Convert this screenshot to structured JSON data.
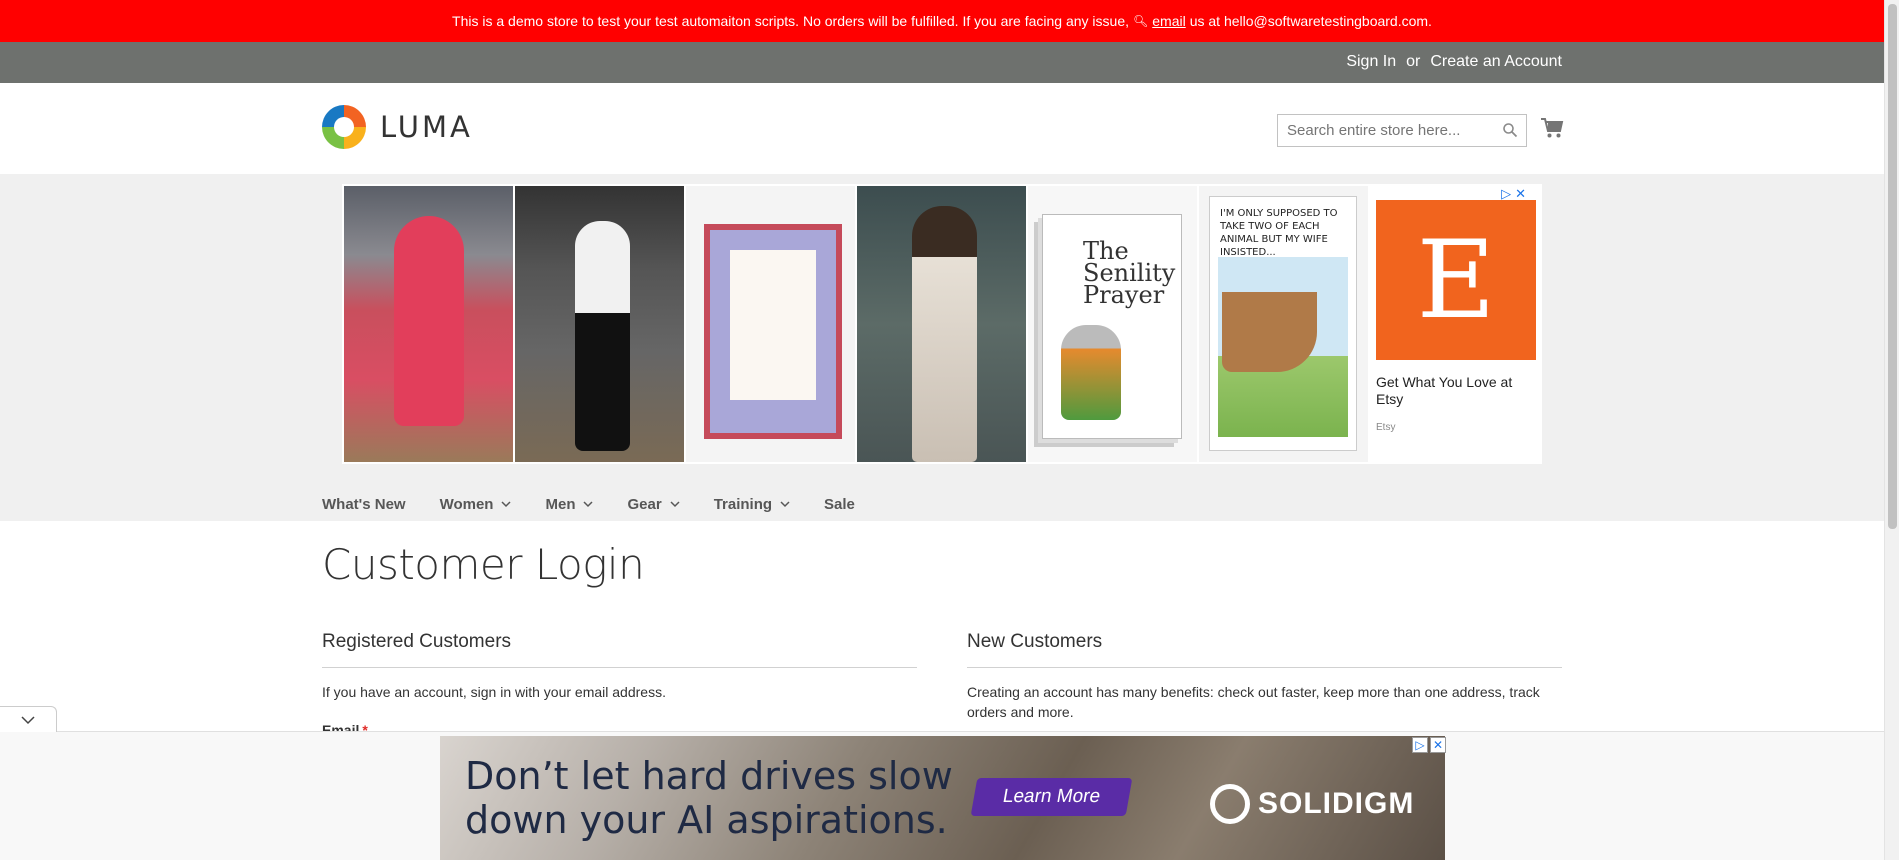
{
  "demo_notice": {
    "text_before": "This is a demo store to test your test automaiton scripts. No orders will be fulfilled. If you are facing any issue,",
    "link": "email",
    "text_after": "us at hello@softwaretestingboard.com."
  },
  "header_links": {
    "sign_in": "Sign In",
    "or": "or",
    "create_account": "Create an Account"
  },
  "logo": {
    "text": "LUMA"
  },
  "search": {
    "placeholder": "Search entire store here..."
  },
  "ads": {
    "card_caption": "I'M ONLY SUPPOSED TO TAKE TWO OF EACH ANIMAL BUT MY WIFE INSISTED...",
    "card_title": "The Senility Prayer",
    "etsy": {
      "logo_letter": "E",
      "headline": "Get What You Love at Etsy",
      "source": "Etsy"
    }
  },
  "nav": {
    "items": [
      {
        "label": "What's New"
      },
      {
        "label": "Women"
      },
      {
        "label": "Men"
      },
      {
        "label": "Gear"
      },
      {
        "label": "Training"
      },
      {
        "label": "Sale"
      }
    ]
  },
  "page": {
    "title": "Customer Login",
    "registered": {
      "title": "Registered Customers",
      "text": "If you have an account, sign in with your email address.",
      "email_label": "Email",
      "required_mark": "*"
    },
    "new_customers": {
      "title": "New Customers",
      "text": "Creating an account has many benefits: check out faster, keep more than one address, track orders and more."
    }
  },
  "banner": {
    "headline": "Don’t let hard drives slow down your AI aspirations.",
    "cta": "Learn More",
    "brand": "SOLIDIGM"
  },
  "colors": {
    "demo_bar": "#ff0000",
    "header_bar": "#6e716e",
    "etsy_orange": "#f1641e",
    "cta_purple": "#5a2ca6"
  }
}
